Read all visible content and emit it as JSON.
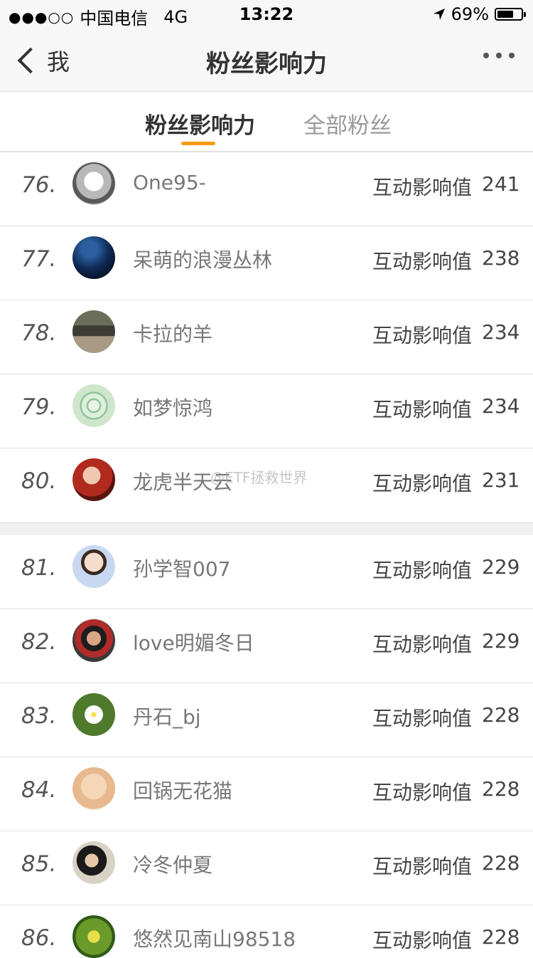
{
  "status_bar": {
    "signal": "●●●○○",
    "carrier": "中国电信",
    "network": "4G",
    "time": "13:22",
    "battery": "69%",
    "battery_level": 0.69
  },
  "nav": {
    "back_label": "我",
    "title": "粉丝影响力"
  },
  "tabs": [
    {
      "label": "粉丝影响力",
      "active": true
    },
    {
      "label": "全部粉丝",
      "active": false
    }
  ],
  "watermark": "@ETF拯救世界",
  "list": [
    {
      "rank": "76.",
      "name": "One95-",
      "metric_label": "互动影响值",
      "value": "241"
    },
    {
      "rank": "77.",
      "name": "呆萌的浪漫丛林",
      "metric_label": "互动影响值",
      "value": "238"
    },
    {
      "rank": "78.",
      "name": "卡拉的羊",
      "metric_label": "互动影响值",
      "value": "234"
    },
    {
      "rank": "79.",
      "name": "如梦惊鸿",
      "metric_label": "互动影响值",
      "value": "234"
    },
    {
      "rank": "80.",
      "name": "龙虎半天云",
      "metric_label": "互动影响值",
      "value": "231"
    },
    {
      "rank": "81.",
      "name": "孙学智007",
      "metric_label": "互动影响值",
      "value": "229"
    },
    {
      "rank": "82.",
      "name": "love明媚冬日",
      "metric_label": "互动影响值",
      "value": "229"
    },
    {
      "rank": "83.",
      "name": "丹石_bj",
      "metric_label": "互动影响值",
      "value": "228"
    },
    {
      "rank": "84.",
      "name": "回锅无花猫",
      "metric_label": "互动影响值",
      "value": "228"
    },
    {
      "rank": "85.",
      "name": "冷冬仲夏",
      "metric_label": "互动影响值",
      "value": "228"
    },
    {
      "rank": "86.",
      "name": "悠然见南山98518",
      "metric_label": "互动影响值",
      "value": "228"
    }
  ],
  "colors": {
    "accent": "#f39c12",
    "bar_bg": "#f7f7f7"
  }
}
